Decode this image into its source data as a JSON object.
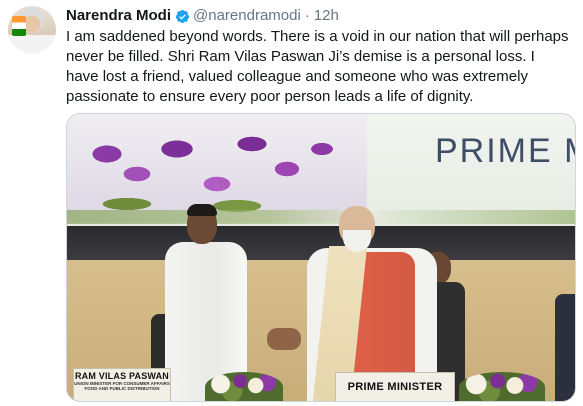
{
  "tweet": {
    "author_name": "Narendra Modi",
    "verified_icon": "verified-badge-icon",
    "handle": "@narendramodi",
    "separator": "·",
    "time": "12h",
    "text": "I am saddened beyond words. There is a void in our nation that will perhaps never be filled. Shri Ram Vilas Paswan Ji’s demise is a personal loss. I have lost a friend, valued colleague and someone who was extremely passionate to ensure every poor person leads a life of dignity."
  },
  "media": {
    "banner_text": "PRIME MI",
    "nameplate_left": {
      "title": "RAM VILAS PASWAN",
      "subtitle_line1": "UNION MINISTER FOR CONSUMER AFFAIRS",
      "subtitle_line2": "FOOD AND PUBLIC DISTRIBUTION"
    },
    "nameplate_right": {
      "title": "PRIME MINISTER"
    }
  },
  "colors": {
    "accent_verified": "#1da1f2",
    "text_primary": "#14171a",
    "text_secondary": "#657786"
  }
}
